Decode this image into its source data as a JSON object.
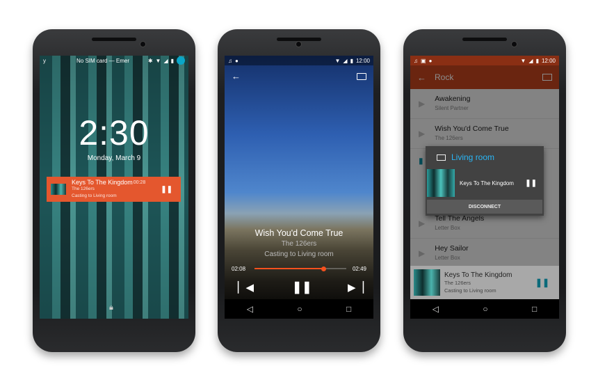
{
  "lock": {
    "status_left": "y",
    "carrier": "No SIM card — Emer",
    "time": "2:30",
    "date": "Monday, March 9",
    "notification": {
      "title": "Keys To The Kingdom",
      "artist": "The 126ers",
      "subtitle": "Casting to Living room",
      "elapsed": "00:28",
      "color": "#e4572e"
    }
  },
  "player": {
    "clock": "12:00",
    "title": "Wish You'd Come True",
    "artist": "The 126ers",
    "subtitle": "Casting to Living room",
    "elapsed": "02:08",
    "duration": "02:49",
    "progress": 0.757,
    "accent": "#f4511e"
  },
  "list": {
    "clock": "12:00",
    "header": "Rock",
    "header_color": "#c1441e",
    "songs": [
      {
        "title": "Awakening",
        "artist": "Silent Partner"
      },
      {
        "title": "Wish You'd Come True",
        "artist": "The 126ers"
      },
      {
        "title": "Tell The Angels",
        "artist": "Letter Box"
      },
      {
        "title": "Hey Sailor",
        "artist": "Letter Box"
      }
    ],
    "dialog": {
      "title": "Living room",
      "track": "Keys To The Kingdom",
      "button": "DISCONNECT",
      "accent": "#29b6f6"
    },
    "mini": {
      "title": "Keys To The Kingdom",
      "artist": "The 126ers",
      "subtitle": "Casting to Living room"
    }
  }
}
